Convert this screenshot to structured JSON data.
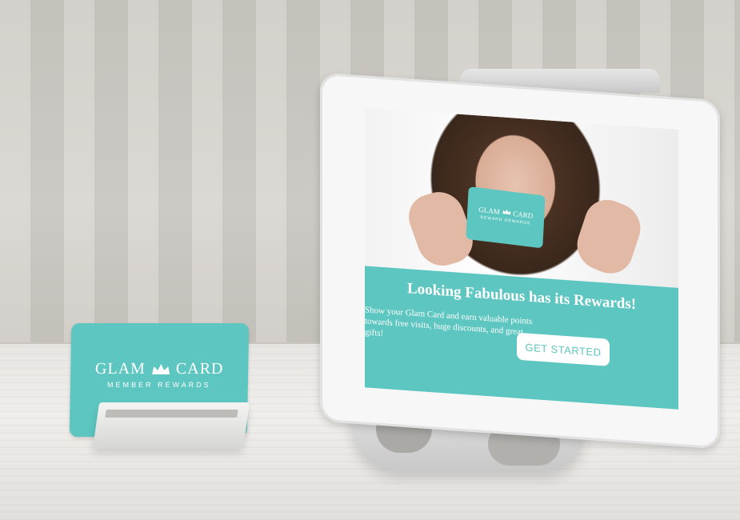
{
  "colors": {
    "brand_teal": "#5ec6c0",
    "white": "#ffffff"
  },
  "card": {
    "brand_left": "GLAM",
    "brand_right": "CARD",
    "tagline": "MEMBER REWARDS"
  },
  "screen": {
    "card_brand_left": "GLAM",
    "card_brand_right": "CARD",
    "card_tagline": "REWARD REWARDS",
    "headline": "Looking Fabulous has its Rewards!",
    "body": "Show your Glam Card and earn valuable points towards free visits, huge discounts, and great gifts!",
    "cta_label": "GET STARTED"
  },
  "icons": [
    "crown-icon"
  ]
}
